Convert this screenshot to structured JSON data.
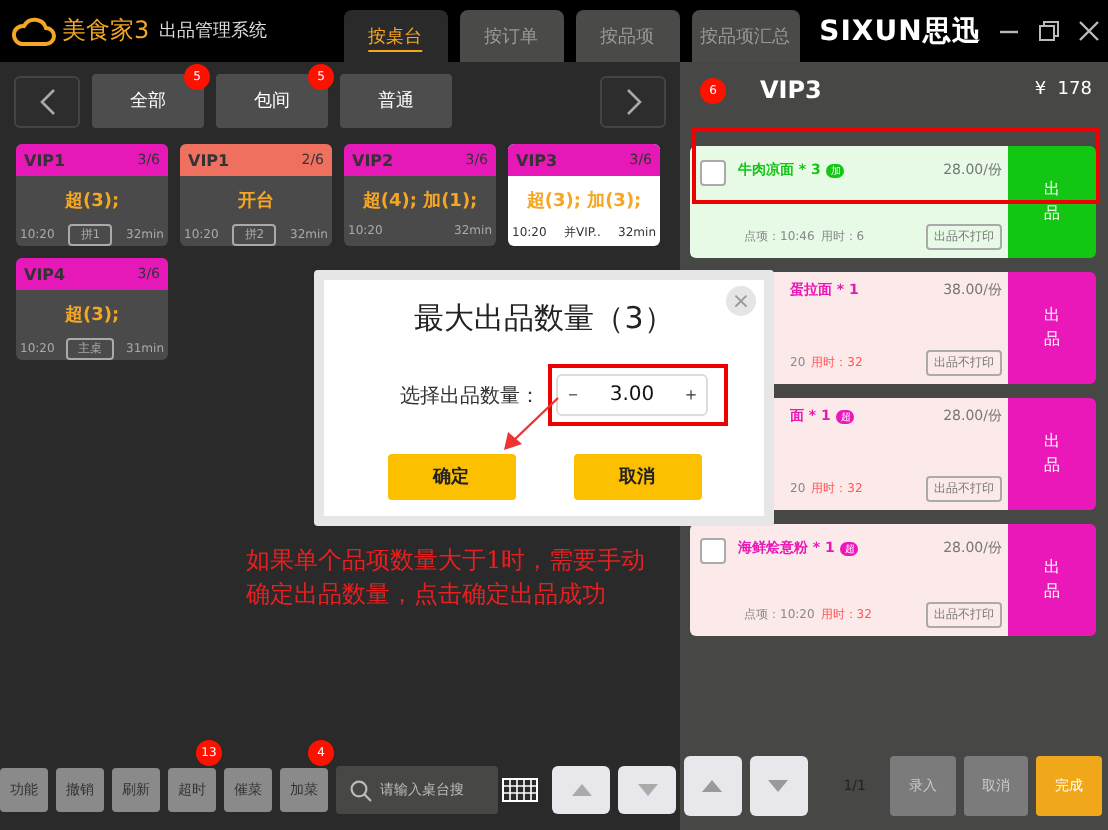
{
  "app": {
    "logo": "美食家3",
    "subtitle": "出品管理系统",
    "brand": "SIXUN思迅"
  },
  "tabs": [
    {
      "label": "按桌台",
      "selected": true
    },
    {
      "label": "按订单",
      "selected": false
    },
    {
      "label": "按品项",
      "selected": false
    },
    {
      "label": "按品项汇总",
      "selected": false
    }
  ],
  "categories": [
    {
      "label": "全部",
      "badge": "5"
    },
    {
      "label": "包间",
      "badge": "5"
    },
    {
      "label": "普通"
    }
  ],
  "tables": [
    {
      "name": "VIP1",
      "count": "3/6",
      "color": "#e619b8",
      "status": "超(3);",
      "time": "10:20",
      "tag": "拼1",
      "duration": "32min",
      "selected": false
    },
    {
      "name": "VIP1",
      "count": "2/6",
      "color": "#f0705f",
      "status": "开台",
      "time": "10:20",
      "tag": "拼2",
      "duration": "32min",
      "selected": false
    },
    {
      "name": "VIP2",
      "count": "3/6",
      "color": "#e619b8",
      "status": "超(4); 加(1);",
      "time": "10:20",
      "duration": "32min",
      "selected": false
    },
    {
      "name": "VIP3",
      "count": "3/6",
      "color": "#e619b8",
      "status": "超(3); 加(3);",
      "time": "10:20",
      "note": "并VIP..",
      "duration": "32min",
      "selected": true
    },
    {
      "name": "VIP4",
      "count": "3/6",
      "color": "#e619b8",
      "status": "超(3);",
      "time": "10:20",
      "tag": "主桌",
      "duration": "31min",
      "selected": false
    }
  ],
  "toolbar": [
    {
      "label": "功能"
    },
    {
      "label": "撤销"
    },
    {
      "label": "刷新"
    },
    {
      "label": "超时",
      "badge": "13"
    },
    {
      "label": "催菜"
    },
    {
      "label": "加菜",
      "badge": "4"
    }
  ],
  "search": {
    "placeholder": "请输入桌台搜"
  },
  "order": {
    "badge": "6",
    "table": "VIP3",
    "total": "¥  178",
    "items": [
      {
        "name": "牛肉凉面 * 3",
        "tag": "加",
        "price": "28.00/份",
        "ordered": "点项：10:46",
        "elapsed": "用时：6",
        "overdue": false,
        "print_label": "出品不打印",
        "action": "出品",
        "color": "#13c613",
        "obscured": false
      },
      {
        "name": "蛋拉面 * 1",
        "price": "38.00/份",
        "ordered": "20",
        "elapsed": "用时：32",
        "overdue": true,
        "print_label": "出品不打印",
        "action": "出品",
        "color": "#ea17b9",
        "obscured": true
      },
      {
        "name": "面 * 1",
        "tag": "超",
        "price": "28.00/份",
        "ordered": "20",
        "elapsed": "用时：32",
        "overdue": true,
        "print_label": "出品不打印",
        "action": "出品",
        "color": "#ea17b9",
        "obscured": true
      },
      {
        "name": "海鲜烩意粉 * 1",
        "tag": "超",
        "price": "28.00/份",
        "ordered": "点项：10:20",
        "elapsed": "用时：32",
        "overdue": true,
        "print_label": "出品不打印",
        "action": "出品",
        "color": "#ea17b9",
        "obscured": false
      }
    ],
    "page": "1/1",
    "buttons": [
      {
        "label": "录入",
        "kind": "plain"
      },
      {
        "label": "取消",
        "kind": "plain"
      },
      {
        "label": "完成",
        "kind": "primary"
      }
    ]
  },
  "dialog": {
    "title": "最大出品数量（3）",
    "label": "选择出品数量：",
    "minus": "－",
    "value": "3.00",
    "plus": "＋",
    "close": "×",
    "buttons": [
      "确定",
      "取消"
    ]
  },
  "annotation": "如果单个品项数量大于1时，需要手动确定出品数量，点击确定出品成功"
}
